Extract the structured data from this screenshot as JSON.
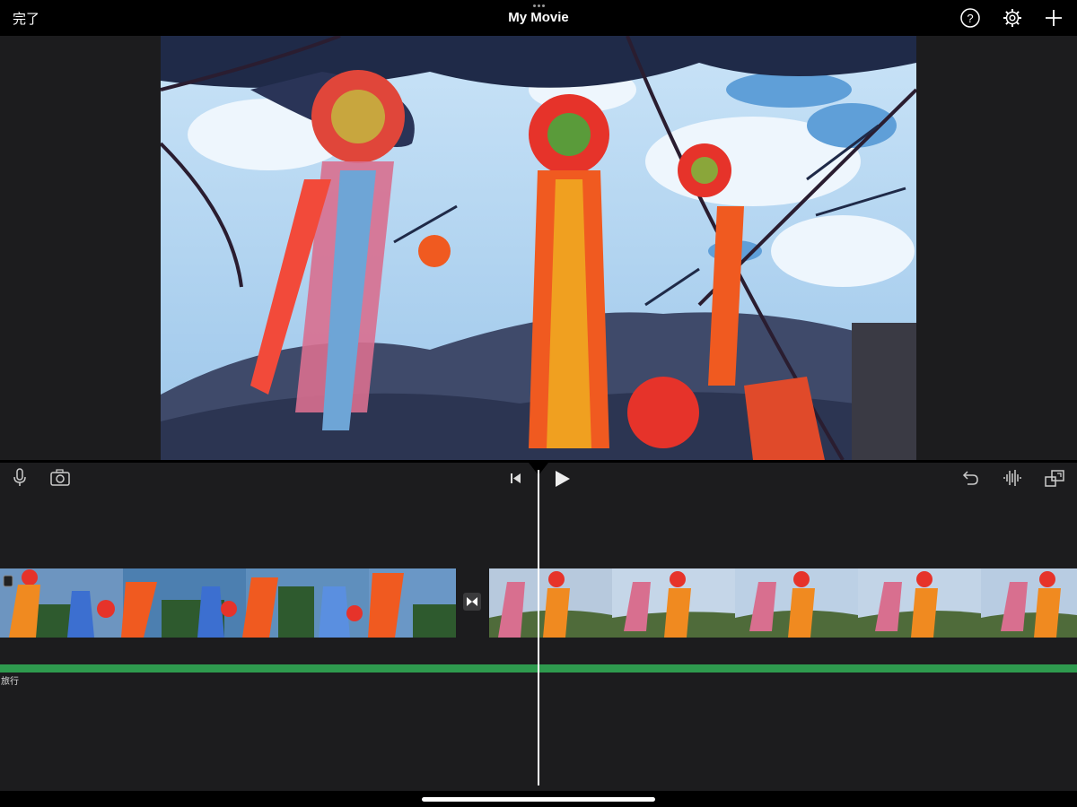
{
  "app": {
    "title": "My Movie",
    "done_label": "完了"
  },
  "toolbar": {
    "help_icon": "help-icon",
    "settings_icon": "gear-icon",
    "add_icon": "plus-icon"
  },
  "timeline": {
    "audio_track_label": "旅行",
    "controls": [
      "microphone-icon",
      "camera-icon",
      "skip-to-start-icon",
      "play-icon",
      "undo-icon",
      "audio-waveform-icon",
      "fullscreen-icon"
    ]
  },
  "colors": {
    "background": "#000000",
    "panel": "#1c1c1e",
    "audio_track": "#2e9a4e",
    "playhead": "#ffffff"
  }
}
